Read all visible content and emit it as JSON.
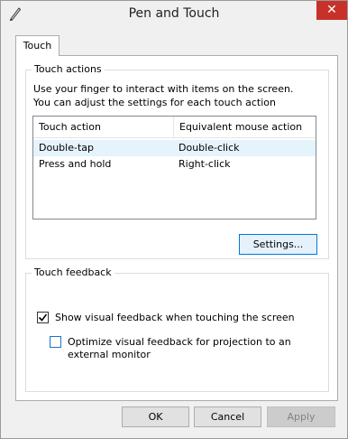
{
  "window": {
    "title": "Pen and Touch",
    "close_glyph": "✕"
  },
  "tabs": [
    {
      "label": "Touch"
    }
  ],
  "touch_actions": {
    "group_label": "Touch actions",
    "description": "Use your finger to interact with items on the screen. You can adjust the settings for each touch action",
    "columns": [
      "Touch action",
      "Equivalent mouse action"
    ],
    "rows": [
      {
        "action": "Double-tap",
        "mouse": "Double-click"
      },
      {
        "action": "Press and hold",
        "mouse": "Right-click"
      }
    ],
    "settings_button": "Settings..."
  },
  "touch_feedback": {
    "group_label": "Touch feedback",
    "show_visual": {
      "label": "Show visual feedback when touching the screen",
      "checked": true
    },
    "optimize_projection": {
      "label": "Optimize visual feedback for projection to an external monitor",
      "checked": false
    }
  },
  "footer": {
    "ok": "OK",
    "cancel": "Cancel",
    "apply": "Apply"
  },
  "colors": {
    "close_button": "#c7312a",
    "hover_row": "#e5f3fb",
    "focus_border": "#0078d7"
  },
  "icons": {
    "app": "pen-icon",
    "check": "checkmark-icon"
  }
}
